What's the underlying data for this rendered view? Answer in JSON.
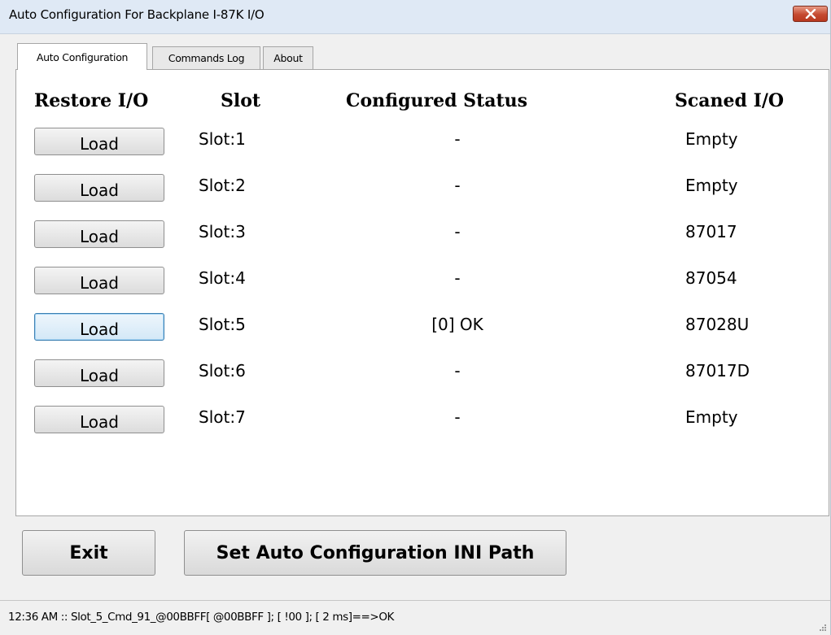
{
  "window": {
    "title": "Auto Configuration For Backplane I-87K I/O"
  },
  "tabs": [
    {
      "label": "Auto Configuration",
      "active": true
    },
    {
      "label": "Commands Log",
      "active": false
    },
    {
      "label": "About",
      "active": false
    }
  ],
  "table": {
    "headers": {
      "restore": "Restore I/O",
      "slot": "Slot",
      "status": "Configured Status",
      "scanned": "Scaned I/O"
    },
    "rows": [
      {
        "button": "Load",
        "slot": "Slot:1",
        "status": "-",
        "scanned": "Empty"
      },
      {
        "button": "Load",
        "slot": "Slot:2",
        "status": "-",
        "scanned": "Empty"
      },
      {
        "button": "Load",
        "slot": "Slot:3",
        "status": "-",
        "scanned": "87017"
      },
      {
        "button": "Load",
        "slot": "Slot:4",
        "status": "-",
        "scanned": "87054"
      },
      {
        "button": "Load",
        "slot": "Slot:5",
        "status": "[0] OK",
        "scanned": "87028U"
      },
      {
        "button": "Load",
        "slot": "Slot:6",
        "status": "-",
        "scanned": "87017D"
      },
      {
        "button": "Load",
        "slot": "Slot:7",
        "status": "-",
        "scanned": "Empty"
      }
    ]
  },
  "footer": {
    "exit_label": "Exit",
    "ini_label": "Set Auto Configuration INI Path"
  },
  "statusbar": {
    "text": "12:36 AM :: Slot_5_Cmd_91_@00BBFF[ @00BBFF ]; [ !00 ]; [ 2 ms]==>OK"
  },
  "colors": {
    "titlebar": "#dfe9f5",
    "close_button": "#c54a30",
    "focus_border": "#3c7fb1"
  }
}
